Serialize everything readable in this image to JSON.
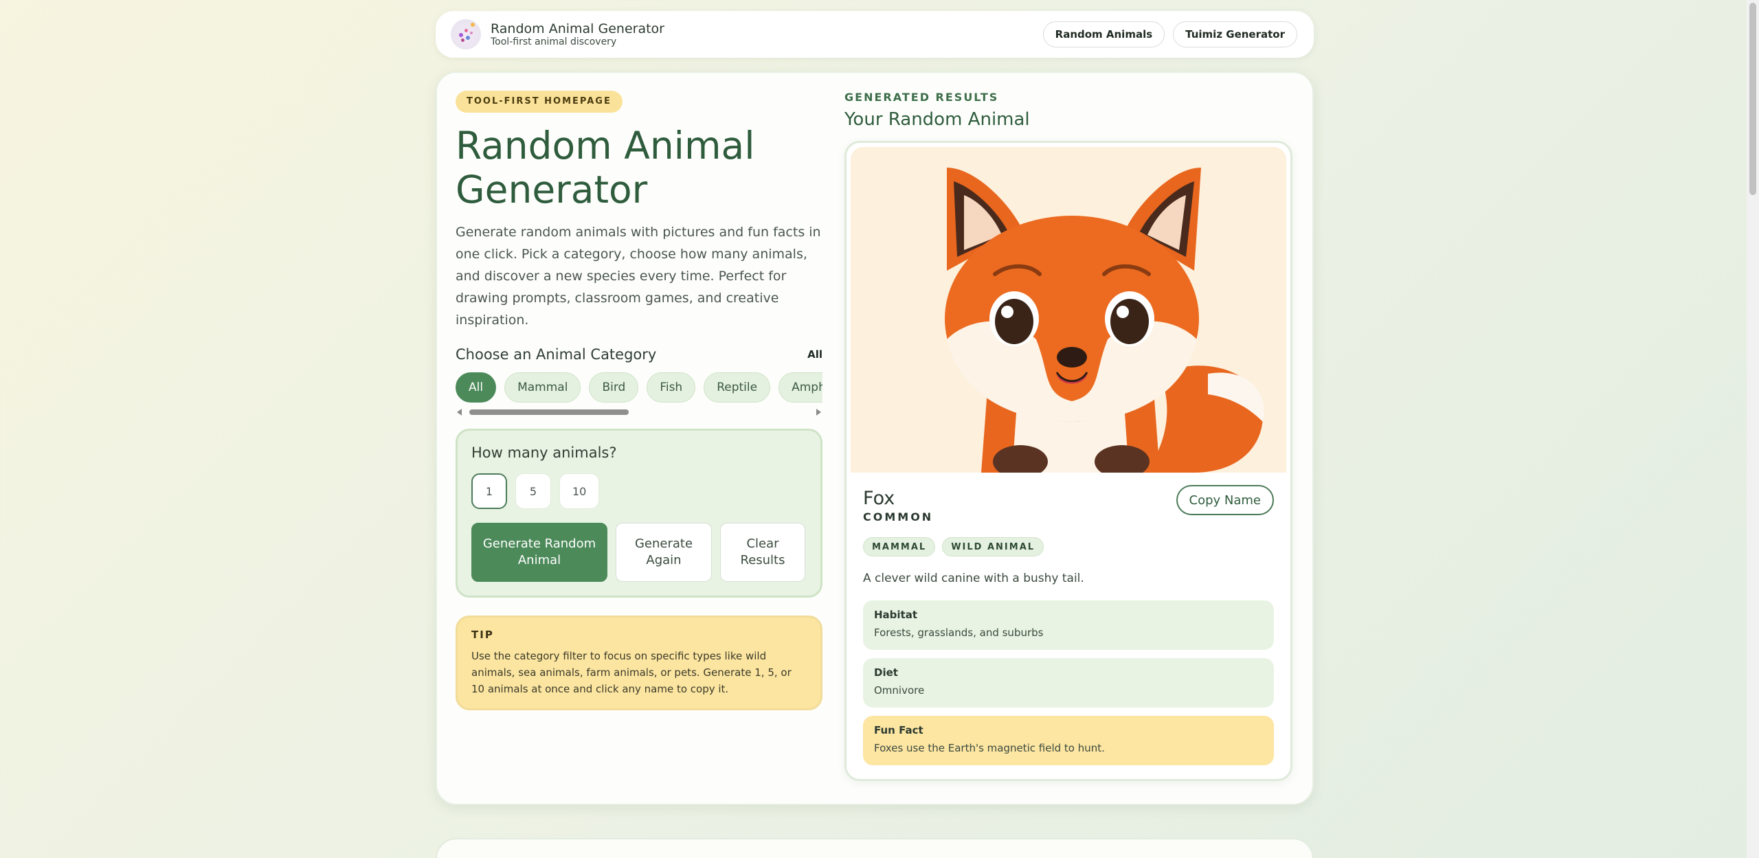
{
  "header": {
    "brand_title": "Random Animal Generator",
    "brand_subtitle": "Tool-first animal discovery",
    "nav": [
      {
        "label": "Random Animals"
      },
      {
        "label": "Tuimiz Generator"
      }
    ]
  },
  "hero": {
    "badge": "TOOL-FIRST HOMEPAGE",
    "title": "Random Animal Generator",
    "description": "Generate random animals with pictures and fun facts in one click. Pick a category, choose how many animals, and discover a new species every time. Perfect for drawing prompts, classroom games, and creative inspiration."
  },
  "category": {
    "title": "Choose an Animal Category",
    "selected_label": "All",
    "chips": [
      {
        "label": "All",
        "active": true
      },
      {
        "label": "Mammal"
      },
      {
        "label": "Bird"
      },
      {
        "label": "Fish"
      },
      {
        "label": "Reptile"
      },
      {
        "label": "Amphibian"
      }
    ]
  },
  "count": {
    "title": "How many animals?",
    "options": [
      "1",
      "5",
      "10"
    ],
    "selected": "1"
  },
  "actions": {
    "generate": "Generate Random Animal",
    "again": "Generate Again",
    "clear": "Clear Results"
  },
  "tip": {
    "label": "TIP",
    "text": "Use the category filter to focus on specific types like wild animals, sea animals, farm animals, or pets. Generate 1, 5, or 10 animals at once and click any name to copy it."
  },
  "results": {
    "eyebrow": "GENERATED RESULTS",
    "title": "Your Random Animal",
    "animal": {
      "name": "Fox",
      "rarity": "COMMON",
      "copy_label": "Copy Name",
      "tags": [
        "MAMMAL",
        "WILD ANIMAL"
      ],
      "description": "A clever wild canine with a bushy tail.",
      "facts": [
        {
          "label": "Habitat",
          "value": "Forests, grasslands, and suburbs"
        },
        {
          "label": "Diet",
          "value": "Omnivore"
        },
        {
          "label": "Fun Fact",
          "value": "Foxes use the Earth's magnetic field to hunt."
        }
      ]
    }
  },
  "colors": {
    "primary_green": "#4c8a5a",
    "title_green": "#2f5c3d",
    "tip_yellow": "#fce5a0",
    "panel_green": "#e8f3e3"
  }
}
